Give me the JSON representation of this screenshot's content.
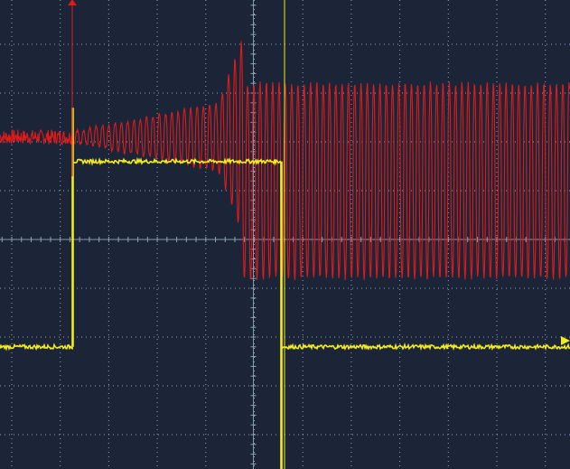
{
  "colors": {
    "background": "#1b2537",
    "grid": "#8fa3b8",
    "channel_1": "#e01a1a",
    "channel_2": "#f2ec1c"
  },
  "icons": {
    "trigger_position_marker": "triangle-up",
    "trigger_level_marker": "triangle-right"
  },
  "display": {
    "horizontal_divisions": 10,
    "vertical_divisions": 8,
    "minor_ticks_per_division": 5
  },
  "traces": {
    "channel_1": {
      "description_free": true,
      "segments": [
        {
          "from": 0.0,
          "to": 1.5,
          "kind": "noise",
          "level": 0.3
        },
        {
          "from": 1.5,
          "to": 4.5,
          "kind": "oscillation-growing",
          "start_amplitude": 0.2,
          "end_amplitude": 1.4
        },
        {
          "from": 4.5,
          "to": 5.0,
          "kind": "oscillation-growing",
          "start_amplitude": 1.4,
          "end_amplitude": 4.0
        },
        {
          "from": 5.0,
          "to": 11.7,
          "kind": "oscillation",
          "amplitude": 4.0
        }
      ]
    },
    "channel_2": {
      "segments": [
        {
          "from": 0.0,
          "to": 1.5,
          "level": -2.2
        },
        {
          "from": 1.5,
          "to": 5.8,
          "level": 1.6
        },
        {
          "from": 5.8,
          "to": 11.7,
          "level": -2.2
        }
      ]
    }
  }
}
